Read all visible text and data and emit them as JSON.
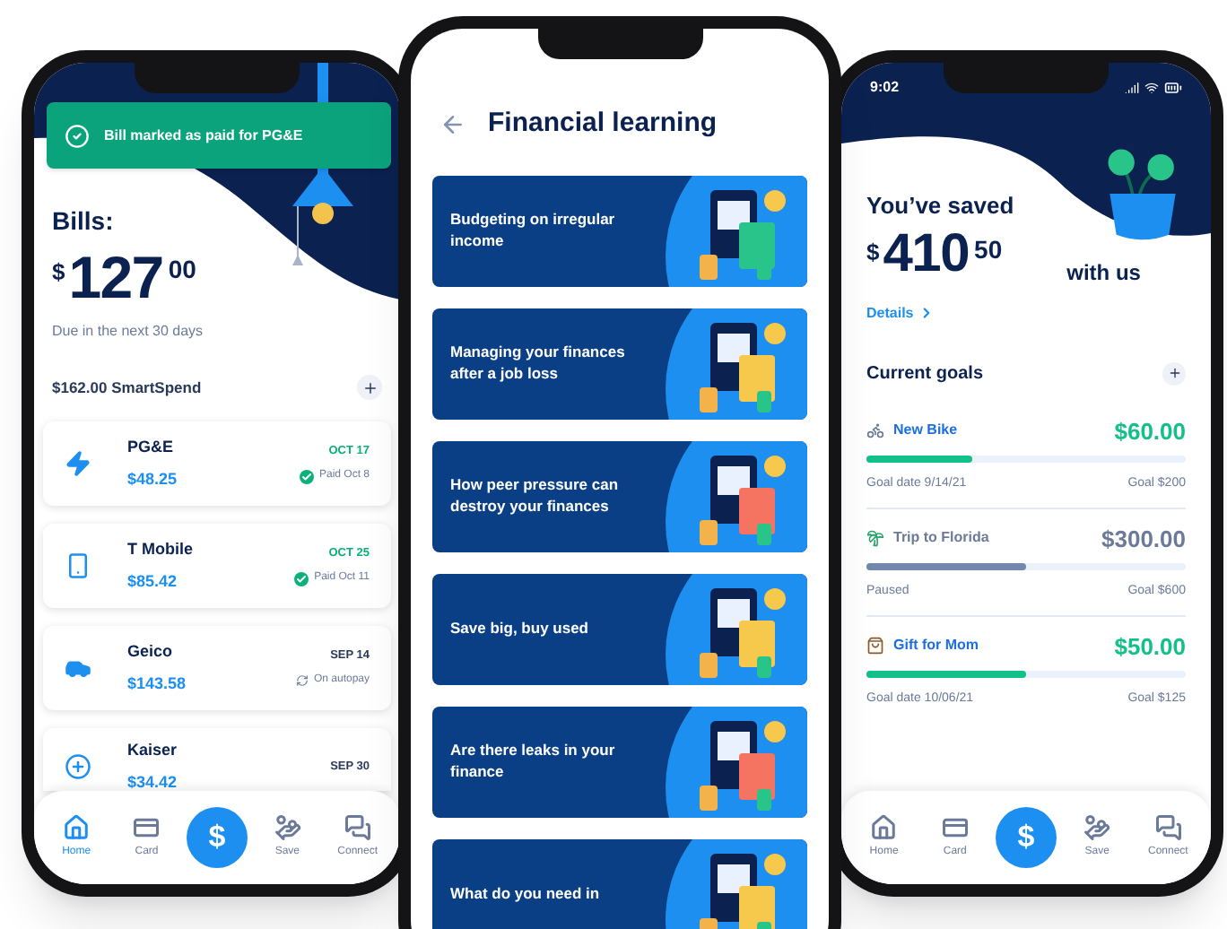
{
  "bills_screen": {
    "toast": "Bill marked as paid for PG&E",
    "title": "Bills:",
    "amount": {
      "currency": "$",
      "whole": "127",
      "cents": "00"
    },
    "due_note": "Due in the next 30 days",
    "smartspend": "$162.00 SmartSpend",
    "bills": [
      {
        "name": "PG&E",
        "amount": "$48.25",
        "date": "OCT 17",
        "status": {
          "kind": "paid",
          "text": "Paid Oct 8"
        }
      },
      {
        "name": "T Mobile",
        "amount": "$85.42",
        "date": "OCT 25",
        "status": {
          "kind": "paid",
          "text": "Paid Oct 11"
        }
      },
      {
        "name": "Geico",
        "amount": "$143.58",
        "date": "SEP 14",
        "status": {
          "kind": "autopay",
          "text": "On autopay"
        }
      },
      {
        "name": "Kaiser",
        "amount": "$34.42",
        "date": "SEP 30"
      }
    ],
    "nav": {
      "center_button": "$",
      "items": [
        {
          "label": "Home",
          "selected": true
        },
        {
          "label": "Card",
          "selected": false
        },
        {
          "label": "Save",
          "selected": false
        },
        {
          "label": "Connect",
          "selected": false
        }
      ]
    }
  },
  "learning_screen": {
    "title": "Financial learning",
    "lessons": [
      {
        "title": "Budgeting on irregular income"
      },
      {
        "title": "Managing your finances after a job loss"
      },
      {
        "title": "How peer pressure can destroy your finances"
      },
      {
        "title": "Save big, buy used"
      },
      {
        "title": "Are there leaks in your finance"
      },
      {
        "title": "What do you need in"
      }
    ]
  },
  "savings_screen": {
    "status_time": "9:02",
    "title": "You’ve saved",
    "amount": {
      "currency": "$",
      "whole": "410",
      "cents": "50"
    },
    "suffix": "with us",
    "details_link": "Details",
    "goals_title": "Current goals",
    "goals": [
      {
        "name": "New Bike",
        "saved": "$60.00",
        "level": 0.33,
        "paused": false,
        "note": "Goal date 9/14/21",
        "goal": "Goal $200"
      },
      {
        "name": "Trip to Florida",
        "saved": "$300.00",
        "level": 0.5,
        "paused": true,
        "note": "Paused",
        "goal": "Goal $600"
      },
      {
        "name": "Gift for Mom",
        "saved": "$50.00",
        "level": 0.5,
        "paused": false,
        "note": "Goal date 10/06/21",
        "goal": "Goal $125"
      }
    ],
    "nav": {
      "center_button": "$",
      "items": [
        {
          "label": "Home",
          "selected": false
        },
        {
          "label": "Card",
          "selected": false
        },
        {
          "label": "Save",
          "selected": false
        },
        {
          "label": "Connect",
          "selected": false
        }
      ]
    }
  }
}
